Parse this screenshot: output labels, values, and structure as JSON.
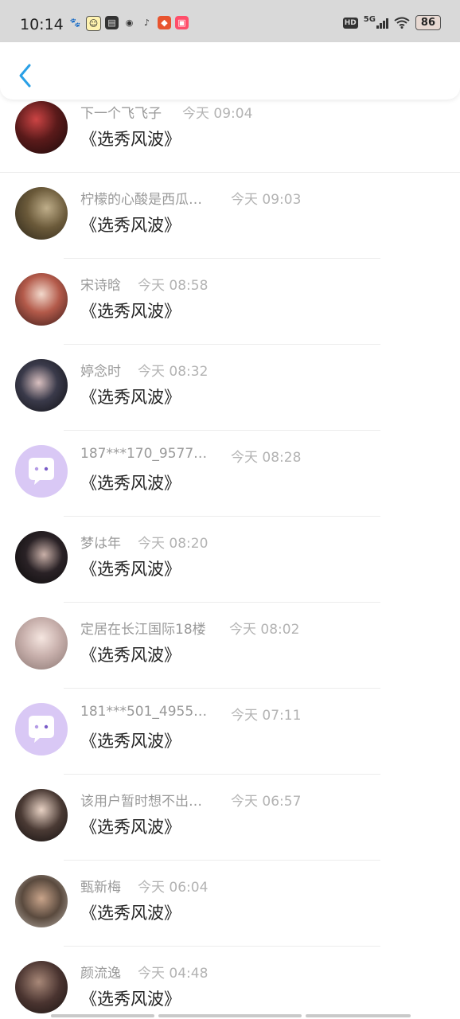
{
  "status_bar": {
    "time": "10:14",
    "network": "5G",
    "battery": "86"
  },
  "colors": {
    "accent": "#2aa0e6",
    "purple_avatar": "#d9c8f5"
  },
  "items": [
    {
      "name": "下一个飞飞子",
      "time": "今天 09:04",
      "message": "《选秀风波》",
      "avatar": "photo"
    },
    {
      "name": "柠檬的心酸是西瓜…",
      "time": "今天 09:03",
      "message": "《选秀风波》",
      "avatar": "photo"
    },
    {
      "name": "宋诗晗",
      "time": "今天 08:58",
      "message": "《选秀风波》",
      "avatar": "photo"
    },
    {
      "name": "婷念时",
      "time": "今天 08:32",
      "message": "《选秀风波》",
      "avatar": "photo"
    },
    {
      "name": "187***170_9577…",
      "time": "今天 08:28",
      "message": "《选秀风波》",
      "avatar": "chat-bubble-icon"
    },
    {
      "name": "梦は年",
      "time": "今天 08:20",
      "message": "《选秀风波》",
      "avatar": "photo"
    },
    {
      "name": "定居在长江国际18楼",
      "time": "今天 08:02",
      "message": "《选秀风波》",
      "avatar": "photo"
    },
    {
      "name": "181***501_4955…",
      "time": "今天 07:11",
      "message": "《选秀风波》",
      "avatar": "chat-bubble-icon"
    },
    {
      "name": "该用户暂时想不出…",
      "time": "今天 06:57",
      "message": "《选秀风波》",
      "avatar": "photo"
    },
    {
      "name": "甄新梅",
      "time": "今天 06:04",
      "message": "《选秀风波》",
      "avatar": "photo"
    },
    {
      "name": "颜流逸",
      "time": "今天 04:48",
      "message": "《选秀风波》",
      "avatar": "photo"
    }
  ]
}
